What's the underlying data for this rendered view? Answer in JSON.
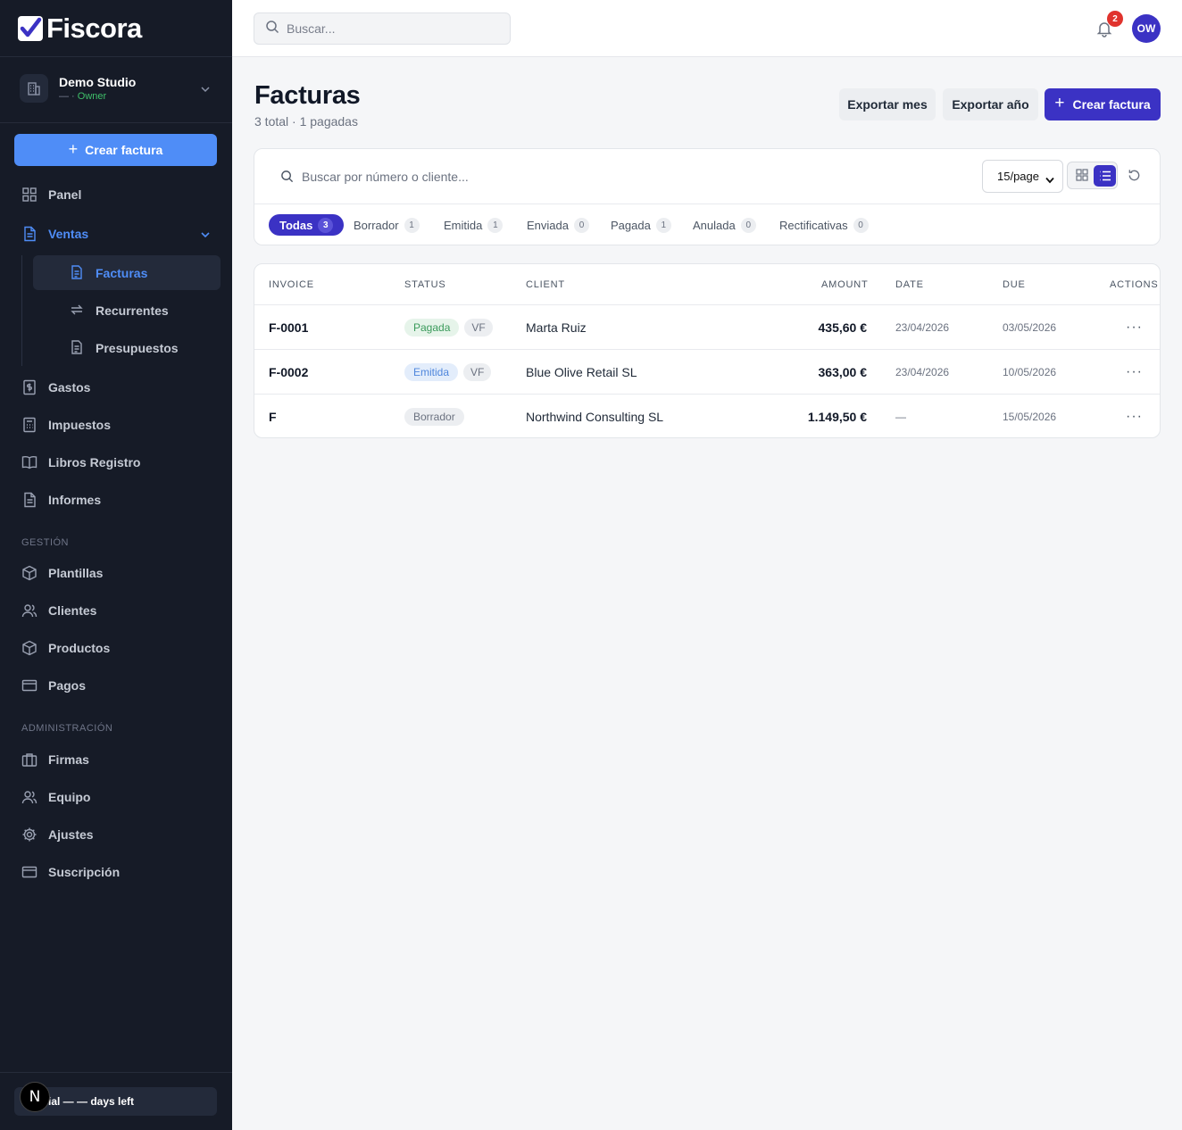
{
  "app": {
    "name": "Fiscora"
  },
  "org": {
    "name": "Demo Studio",
    "role_prefix": "— · ",
    "role": "Owner"
  },
  "sidebar": {
    "cta_label": "Crear factura",
    "items": [
      {
        "label": "Panel",
        "icon": "dashboard-icon"
      },
      {
        "label": "Ventas",
        "icon": "document-icon",
        "active": true
      },
      {
        "label": "Gastos",
        "icon": "receipt-dollar-icon"
      },
      {
        "label": "Impuestos",
        "icon": "calculator-icon"
      },
      {
        "label": "Libros Registro",
        "icon": "book-icon"
      },
      {
        "label": "Informes",
        "icon": "report-icon"
      }
    ],
    "sub_items": [
      {
        "label": "Facturas",
        "icon": "invoice-icon",
        "active": true
      },
      {
        "label": "Recurrentes",
        "icon": "repeat-icon"
      },
      {
        "label": "Presupuestos",
        "icon": "quote-icon"
      }
    ],
    "sections": [
      {
        "title": "GESTIÓN",
        "items": [
          {
            "label": "Plantillas",
            "icon": "box-icon"
          },
          {
            "label": "Clientes",
            "icon": "users-icon"
          },
          {
            "label": "Productos",
            "icon": "package-icon"
          },
          {
            "label": "Pagos",
            "icon": "card-icon"
          }
        ]
      },
      {
        "title": "ADMINISTRACIÓN",
        "items": [
          {
            "label": "Firmas",
            "icon": "briefcase-icon"
          },
          {
            "label": "Equipo",
            "icon": "team-icon"
          },
          {
            "label": "Ajustes",
            "icon": "gear-icon"
          },
          {
            "label": "Suscripción",
            "icon": "card-icon"
          }
        ]
      }
    ],
    "trial_text": "ial — — days left",
    "dev_badge": "N"
  },
  "topbar": {
    "search_placeholder": "Buscar...",
    "notifications_count": "2",
    "avatar_initials": "OW"
  },
  "page": {
    "title": "Facturas",
    "subtitle": "3 total · 1 pagadas",
    "export_month": "Exportar mes",
    "export_year": "Exportar año",
    "create_label": "Crear factura"
  },
  "filters": {
    "search_placeholder": "Buscar por número o cliente...",
    "per_page": "15/page",
    "tabs": [
      {
        "label": "Todas",
        "count": "3",
        "active": true
      },
      {
        "label": "Borrador",
        "count": "1"
      },
      {
        "label": "Emitida",
        "count": "1"
      },
      {
        "label": "Enviada",
        "count": "0"
      },
      {
        "label": "Pagada",
        "count": "1"
      },
      {
        "label": "Anulada",
        "count": "0"
      },
      {
        "label": "Rectificativas",
        "count": "0"
      }
    ]
  },
  "table": {
    "columns": [
      "INVOICE",
      "STATUS",
      "CLIENT",
      "AMOUNT",
      "DATE",
      "DUE",
      "ACTIONS"
    ],
    "rows": [
      {
        "invoice": "F-0001",
        "status": "Pagada",
        "status_color": "#3a9a5b",
        "tag": "VF",
        "client": "Marta Ruiz",
        "amount": "435,60 €",
        "date": "23/04/2026",
        "due": "03/05/2026",
        "actions": "···"
      },
      {
        "invoice": "F-0002",
        "status": "Emitida",
        "status_color": "#4f86dc",
        "tag": "VF",
        "client": "Blue Olive Retail SL",
        "amount": "363,00 €",
        "date": "23/04/2026",
        "due": "10/05/2026",
        "actions": "···"
      },
      {
        "invoice": "F",
        "status": "Borrador",
        "status_color": "#6b7280",
        "client": "Northwind Consulting SL",
        "amount": "1.149,50 €",
        "date": "—",
        "due": "15/05/2026",
        "actions": "···"
      }
    ]
  },
  "colors": {
    "sidebar_bg": "#161b27",
    "accent": "#3b32c4",
    "link_blue": "#4f8df7",
    "badge_red": "#e0332d"
  }
}
